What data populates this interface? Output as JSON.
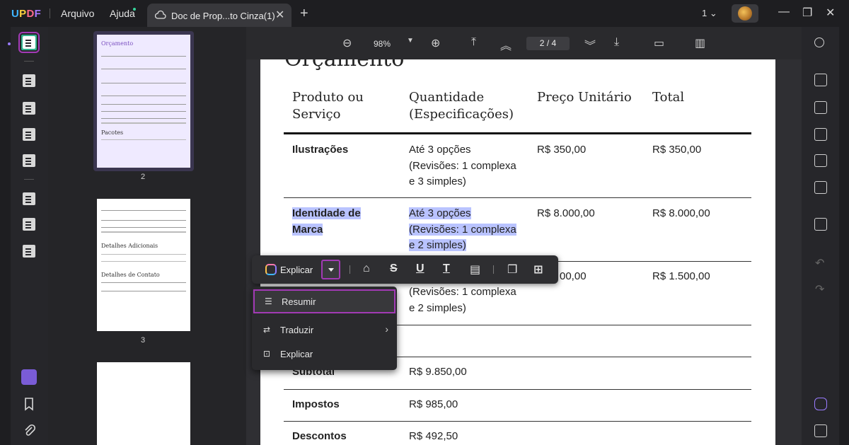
{
  "app": {
    "logo": "UPDF",
    "menus": [
      "Arquivo",
      "Ajuda"
    ],
    "tab_title": "Doc de Prop...to Cinza(1)",
    "page_selector": "1"
  },
  "toolbar": {
    "zoom": "98%",
    "current_page": "2",
    "total_pages": "4",
    "page_separator": "/"
  },
  "thumbnails": {
    "labels": [
      "2",
      "3"
    ],
    "page2_title": "Orçamento",
    "page2_sub": "Pacotes",
    "page3_h1": "Detalhes Adicionais",
    "page3_h2": "Detalhes de Contato"
  },
  "document": {
    "heading": "Orçamento",
    "headers": [
      "Produto ou Serviço",
      "Quantidade (Especificações)",
      "Preço Unitário",
      "Total"
    ],
    "rows": [
      {
        "product": "Ilustrações",
        "qty": [
          "Até 3 opções",
          "(Revisões: 1 complexa",
          "e 3 simples)"
        ],
        "unit": "R$ 350,00",
        "total": "R$ 350,00"
      },
      {
        "product": [
          "Identidade de",
          "Marca"
        ],
        "qty": [
          "Até 3 opções",
          "(Revisões: 1 complexa",
          "e 2 simples)"
        ],
        "unit": "R$ 8.000,00",
        "total": "R$ 8.000,00"
      },
      {
        "qty": [
          "(Revisões: 1 complexa",
          "e 2 simples)"
        ],
        "unit": "00,00",
        "total": "R$ 1.500,00"
      }
    ],
    "subtotal_label": "Subtotal",
    "subtotal_value": "R$ 9.850,00",
    "taxes_label": "Impostos",
    "taxes_value": "R$ 985,00",
    "discounts_label": "Descontos",
    "discounts_value": "R$ 492,50"
  },
  "floating_toolbar": {
    "explain_label": "Explicar"
  },
  "dropdown": {
    "items": [
      "Resumir",
      "Traduzir",
      "Explicar"
    ]
  }
}
